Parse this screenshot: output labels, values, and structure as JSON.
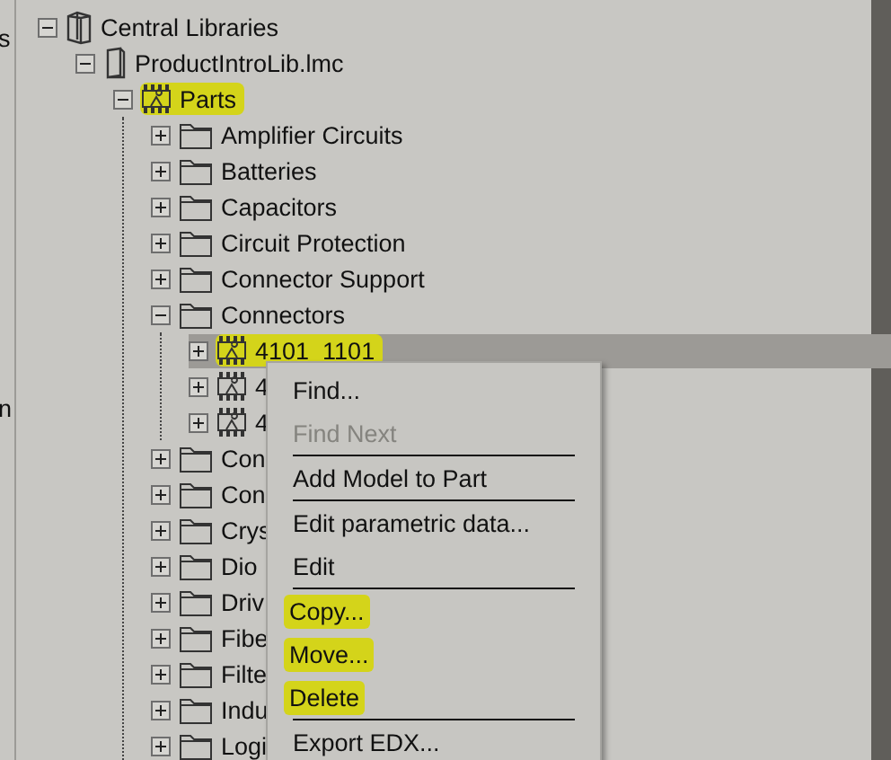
{
  "side_panel": {
    "texts": [
      "s",
      "n"
    ]
  },
  "tree": [
    {
      "label": "Central Libraries",
      "kind": "library",
      "expanded": true,
      "selected": false,
      "highlighted": false,
      "children": [
        {
          "label": "ProductIntroLib.lmc",
          "kind": "file",
          "expanded": true,
          "selected": false,
          "highlighted": false,
          "children": [
            {
              "label": "Parts",
              "kind": "part",
              "expanded": true,
              "selected": false,
              "highlighted": true,
              "children": [
                {
                  "label": "Amplifier Circuits",
                  "kind": "folder",
                  "expanded": false,
                  "selected": false,
                  "highlighted": false
                },
                {
                  "label": "Batteries",
                  "kind": "folder",
                  "expanded": false,
                  "selected": false,
                  "highlighted": false
                },
                {
                  "label": "Capacitors",
                  "kind": "folder",
                  "expanded": false,
                  "selected": false,
                  "highlighted": false
                },
                {
                  "label": "Circuit Protection",
                  "kind": "folder",
                  "expanded": false,
                  "selected": false,
                  "highlighted": false
                },
                {
                  "label": "Connector Support",
                  "kind": "folder",
                  "expanded": false,
                  "selected": false,
                  "highlighted": false
                },
                {
                  "label": "Connectors",
                  "kind": "folder",
                  "expanded": true,
                  "selected": false,
                  "highlighted": false,
                  "children": [
                    {
                      "label": "4101_1101",
                      "kind": "part",
                      "expanded": false,
                      "selected": true,
                      "highlighted": true
                    },
                    {
                      "label": "4",
                      "kind": "part",
                      "expanded": false,
                      "selected": false,
                      "highlighted": false
                    },
                    {
                      "label": "4",
                      "kind": "part",
                      "expanded": false,
                      "selected": false,
                      "highlighted": false
                    }
                  ]
                },
                {
                  "label": "Con",
                  "kind": "folder",
                  "expanded": false,
                  "selected": false,
                  "highlighted": false
                },
                {
                  "label": "Con",
                  "kind": "folder",
                  "expanded": false,
                  "selected": false,
                  "highlighted": false
                },
                {
                  "label": "Crys",
                  "kind": "folder",
                  "expanded": false,
                  "selected": false,
                  "highlighted": false
                },
                {
                  "label": "Dio",
                  "kind": "folder",
                  "expanded": false,
                  "selected": false,
                  "highlighted": false
                },
                {
                  "label": "Driv",
                  "kind": "folder",
                  "expanded": false,
                  "selected": false,
                  "highlighted": false
                },
                {
                  "label": "Fibe",
                  "kind": "folder",
                  "expanded": false,
                  "selected": false,
                  "highlighted": false
                },
                {
                  "label": "Filte",
                  "kind": "folder",
                  "expanded": false,
                  "selected": false,
                  "highlighted": false
                },
                {
                  "label": "Indu",
                  "kind": "folder",
                  "expanded": false,
                  "selected": false,
                  "highlighted": false
                },
                {
                  "label": "Logi",
                  "kind": "folder",
                  "expanded": false,
                  "selected": false,
                  "highlighted": false
                }
              ]
            }
          ]
        }
      ]
    }
  ],
  "context_menu": [
    {
      "kind": "item",
      "label": "Find...",
      "disabled": false,
      "highlighted": false
    },
    {
      "kind": "item",
      "label": "Find Next",
      "disabled": true,
      "highlighted": false
    },
    {
      "kind": "separator"
    },
    {
      "kind": "item",
      "label": "Add Model to Part",
      "disabled": false,
      "highlighted": false
    },
    {
      "kind": "separator"
    },
    {
      "kind": "item",
      "label": "Edit parametric data...",
      "disabled": false,
      "highlighted": false
    },
    {
      "kind": "item",
      "label": "Edit",
      "disabled": false,
      "highlighted": false
    },
    {
      "kind": "separator"
    },
    {
      "kind": "item",
      "label": "Copy...",
      "disabled": false,
      "highlighted": true
    },
    {
      "kind": "item",
      "label": "Move...",
      "disabled": false,
      "highlighted": true
    },
    {
      "kind": "item",
      "label": "Delete",
      "disabled": false,
      "highlighted": true
    },
    {
      "kind": "separator"
    },
    {
      "kind": "item",
      "label": "Export EDX...",
      "disabled": false,
      "highlighted": false
    }
  ]
}
